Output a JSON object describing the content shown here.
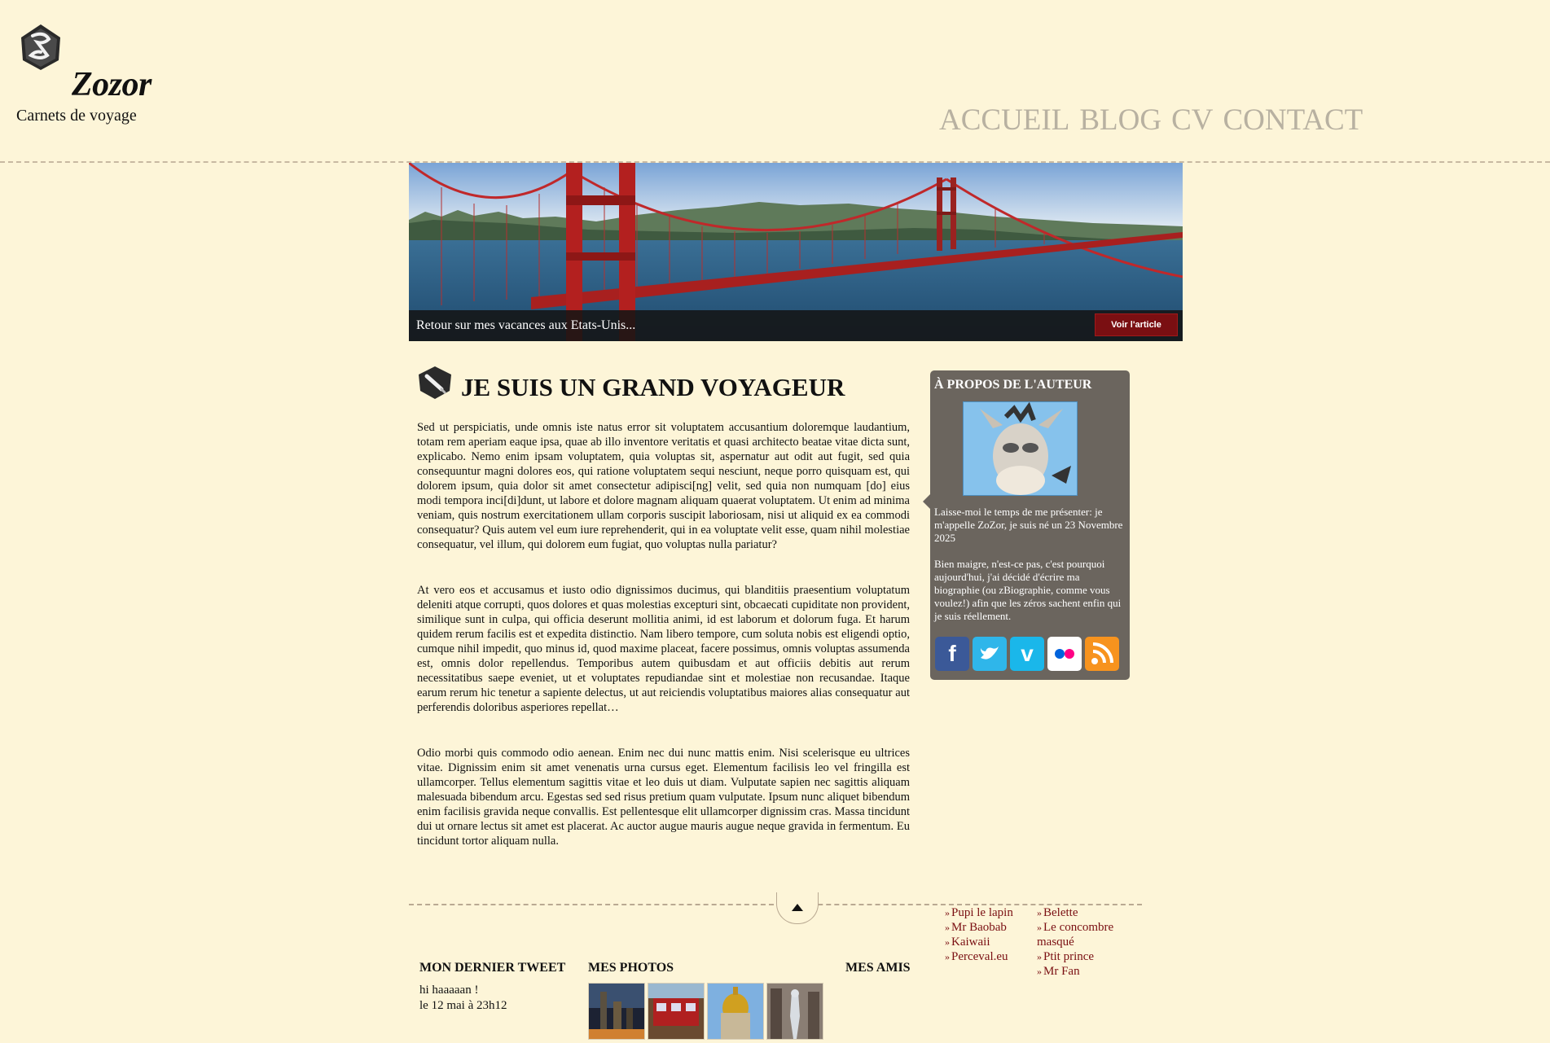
{
  "site": {
    "title": "Zozor",
    "tagline": "Carnets de voyage"
  },
  "nav": {
    "items": [
      "ACCUEIL",
      "BLOG",
      "CV",
      "CONTACT"
    ]
  },
  "banner": {
    "caption": "Retour sur mes vacances aux Etats-Unis...",
    "button_label": "Voir l'article"
  },
  "article": {
    "title": "JE SUIS UN GRAND VOYAGEUR",
    "paragraphs": [
      "Sed ut perspiciatis, unde omnis iste natus error sit voluptatem accusantium doloremque laudantium, totam rem aperiam eaque ipsa, quae ab illo inventore veritatis et quasi architecto beatae vitae dicta sunt, explicabo. Nemo enim ipsam voluptatem, quia voluptas sit, aspernatur aut odit aut fugit, sed quia consequuntur magni dolores eos, qui ratione voluptatem sequi nesciunt, neque porro quisquam est, qui dolorem ipsum, quia dolor sit amet consectetur adipisci[ng] velit, sed quia non numquam [do] eius modi tempora inci[di]dunt, ut labore et dolore magnam aliquam quaerat voluptatem. Ut enim ad minima veniam, quis nostrum exercitationem ullam corporis suscipit laboriosam, nisi ut aliquid ex ea commodi consequatur? Quis autem vel eum iure reprehenderit, qui in ea voluptate velit esse, quam nihil molestiae consequatur, vel illum, qui dolorem eum fugiat, quo voluptas nulla pariatur?",
      "At vero eos et accusamus et iusto odio dignissimos ducimus, qui blanditiis praesentium voluptatum deleniti atque corrupti, quos dolores et quas molestias excepturi sint, obcaecati cupiditate non provident, similique sunt in culpa, qui officia deserunt mollitia animi, id est laborum et dolorum fuga. Et harum quidem rerum facilis est et expedita distinctio. Nam libero tempore, cum soluta nobis est eligendi optio, cumque nihil impedit, quo minus id, quod maxime placeat, facere possimus, omnis voluptas assumenda est, omnis dolor repellendus. Temporibus autem quibusdam et aut officiis debitis aut rerum necessitatibus saepe eveniet, ut et voluptates repudiandae sint et molestiae non recusandae. Itaque earum rerum hic tenetur a sapiente delectus, ut aut reiciendis voluptatibus maiores alias consequatur aut perferendis doloribus asperiores repellat…",
      "Odio morbi quis commodo odio aenean. Enim nec dui nunc mattis enim. Nisi scelerisque eu ultrices vitae. Dignissim enim sit amet venenatis urna cursus eget. Elementum facilisis leo vel fringilla est ullamcorper. Tellus elementum sagittis vitae et leo duis ut diam. Vulputate sapien nec sagittis aliquam malesuada bibendum arcu. Egestas sed sed risus pretium quam vulputate. Ipsum nunc aliquet bibendum enim facilisis gravida neque convallis. Est pellentesque elit ullamcorper dignissim cras. Massa tincidunt dui ut ornare lectus sit amet est placerat. Ac auctor augue mauris augue neque gravida in fermentum. Eu tincidunt tortor aliquam nulla."
    ]
  },
  "sidebar": {
    "title": "À PROPOS DE L'AUTEUR",
    "text1": "Laisse-moi le temps de me présenter: je m'appelle ZoZor, je suis né un 23 Novembre 2025",
    "text2": "Bien maigre, n'est-ce pas, c'est pourquoi aujourd'hui, j'ai décidé d'écrire ma biographie (ou zBiographie, comme vous voulez!) afin que les zéros sachent enfin qui je suis réellement.",
    "social": [
      {
        "name": "facebook-icon",
        "glyph": "f",
        "color": "#3b5998"
      },
      {
        "name": "twitter-icon",
        "glyph": "t",
        "color": "#2fb6ea"
      },
      {
        "name": "vimeo-icon",
        "glyph": "v",
        "color": "#1ab7ea"
      },
      {
        "name": "flickr-icon",
        "glyph": "●●",
        "color": "#ffffff"
      },
      {
        "name": "rss-icon",
        "glyph": ")",
        "color": "#f7931e"
      }
    ]
  },
  "footer": {
    "tweet_heading": "MON DERNIER TWEET",
    "tweet_text": "hi haaaaan !",
    "tweet_date": "le 12 mai à 23h12",
    "photos_heading": "MES PHOTOS",
    "friends_heading": "MES AMIS",
    "friends_col1": [
      "Pupi le lapin",
      "Mr Baobab",
      "Kaiwaii",
      "Perceval.eu"
    ],
    "friends_col2": [
      "Belette",
      "Le concombre masqué",
      "Ptit prince",
      "Mr Fan"
    ]
  },
  "colors": {
    "background": "#fdf5d8",
    "nav": "#b8b1a1",
    "sidebar": "#6b655e",
    "accent": "#7a0f12"
  }
}
